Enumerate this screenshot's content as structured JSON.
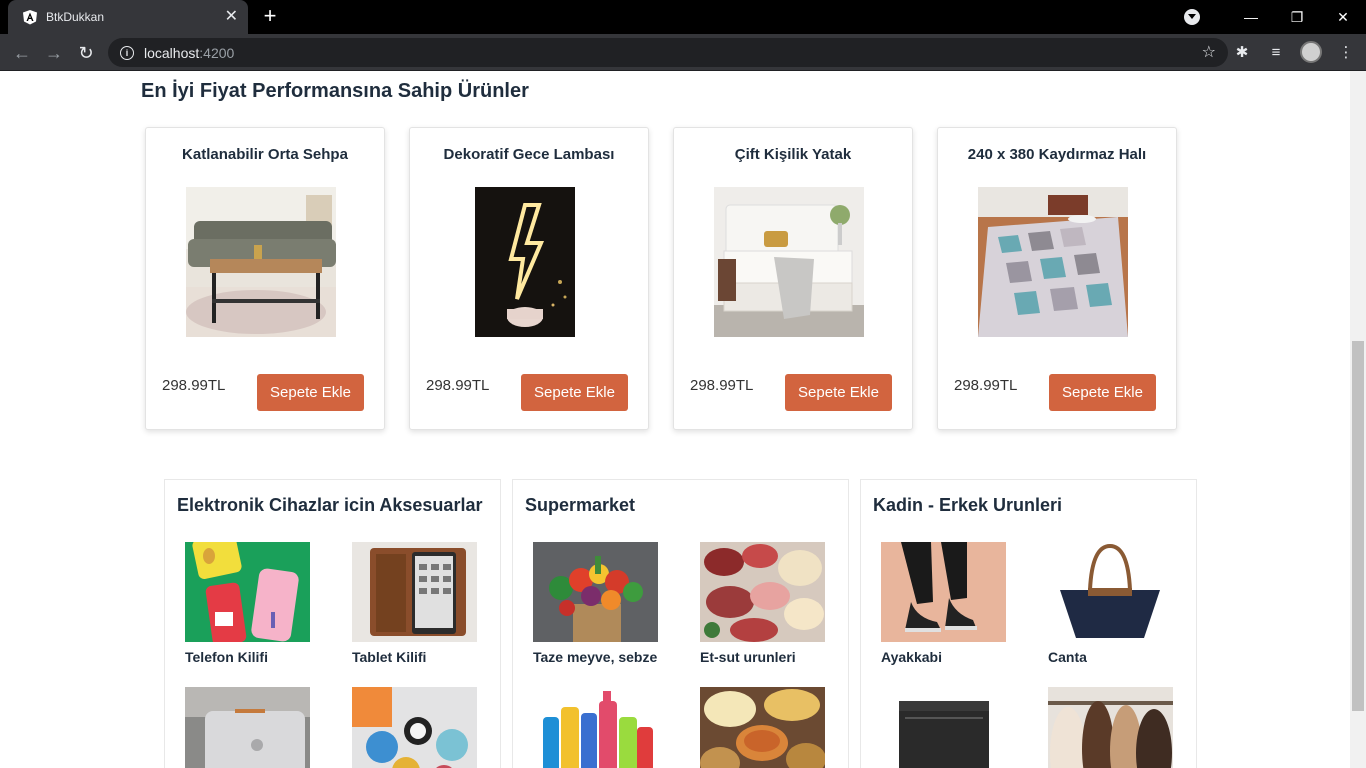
{
  "browser": {
    "tab_title": "BtkDukkan",
    "url_host": "localhost",
    "url_port": ":4200"
  },
  "section": {
    "title": "En İyi Fiyat Performansına Sahip Ürünler"
  },
  "products": [
    {
      "name": "Katlanabilir Orta Sehpa",
      "price": "298.99TL",
      "button": "Sepete Ekle",
      "image": "coffee-table-image"
    },
    {
      "name": "Dekoratif Gece Lambası",
      "price": "298.99TL",
      "button": "Sepete Ekle",
      "image": "neon-lamp-image"
    },
    {
      "name": "Çift Kişilik Yatak",
      "price": "298.99TL",
      "button": "Sepete Ekle",
      "image": "bed-image"
    },
    {
      "name": "240 x 380 Kaydırmaz Halı",
      "price": "298.99TL",
      "button": "Sepete Ekle",
      "image": "rug-image"
    }
  ],
  "categories": [
    {
      "title": "Elektronik Cihazlar icin Aksesuarlar",
      "items": [
        {
          "label": "Telefon Kilifi",
          "image": "phone-case-image"
        },
        {
          "label": "Tablet Kilifi",
          "image": "tablet-case-image"
        },
        {
          "label": "",
          "image": "laptop-sleeve-image"
        },
        {
          "label": "",
          "image": "phone-grip-image"
        }
      ]
    },
    {
      "title": "Supermarket",
      "items": [
        {
          "label": "Taze meyve, sebze",
          "image": "vegetables-image"
        },
        {
          "label": "Et-sut urunleri",
          "image": "meat-dairy-image"
        },
        {
          "label": "",
          "image": "cleaning-products-image"
        },
        {
          "label": "",
          "image": "snacks-image"
        }
      ]
    },
    {
      "title": "Kadin - Erkek Urunleri",
      "items": [
        {
          "label": "Ayakkabi",
          "image": "shoes-image"
        },
        {
          "label": "Canta",
          "image": "bag-image"
        },
        {
          "label": "",
          "image": "wallet-image"
        },
        {
          "label": "",
          "image": "coats-image"
        }
      ]
    }
  ],
  "colors": {
    "button": "#d2643f",
    "heading": "#1f2d3d"
  }
}
